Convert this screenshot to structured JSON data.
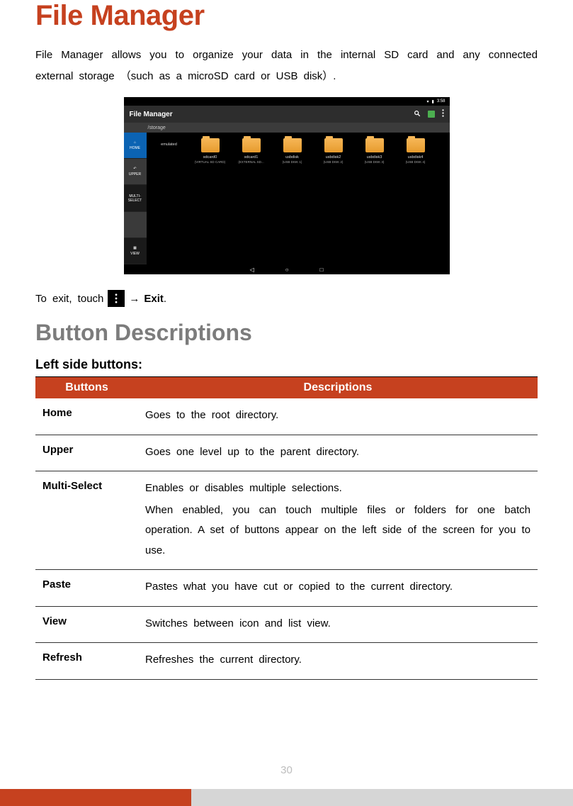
{
  "title": "File Manager",
  "intro": "File Manager allows you to organize your data in the internal SD card and any connected external storage （such as a microSD card or USB disk）.",
  "screenshot": {
    "status_time": "3:58",
    "app_title": "File Manager",
    "path": "/storage",
    "sidebar": [
      "HOME",
      "UPPER",
      "MULTI-SELECT",
      "",
      "VIEW"
    ],
    "items": [
      {
        "label": "emulated",
        "sub": ""
      },
      {
        "label": "sdcard0",
        "sub": "(VIRTUAL SD CARD)"
      },
      {
        "label": "sdcard1",
        "sub": "(EXTERNAL SD..."
      },
      {
        "label": "usbdisk",
        "sub": "(USB DISK 1)"
      },
      {
        "label": "usbdisk2",
        "sub": "(USB DISK 2)"
      },
      {
        "label": "usbdisk3",
        "sub": "(USB DISK 3)"
      },
      {
        "label": "usbdisk4",
        "sub": "(USB DISK 4)"
      }
    ],
    "nav": [
      "◁",
      "○",
      "□"
    ]
  },
  "exit": {
    "pre": "To exit, touch",
    "arrow": "→",
    "exit_label": "Exit",
    "post": "."
  },
  "subtitle": "Button Descriptions",
  "left_side_heading": "Left side buttons:",
  "table": {
    "header_buttons": "Buttons",
    "header_desc": "Descriptions",
    "rows": [
      {
        "name": "Home",
        "desc": [
          "Goes to the root directory."
        ]
      },
      {
        "name": "Upper",
        "desc": [
          "Goes one level up to the parent directory."
        ]
      },
      {
        "name": "Multi-Select",
        "desc": [
          "Enables or disables multiple selections.",
          "When enabled, you can touch multiple files or folders for one batch operation. A set of buttons appear on the left side of the screen for you to use."
        ]
      },
      {
        "name": "Paste",
        "desc": [
          "Pastes what you have cut or copied to the current directory."
        ]
      },
      {
        "name": "View",
        "desc": [
          "Switches between icon and list view."
        ]
      },
      {
        "name": "Refresh",
        "desc": [
          "Refreshes the current directory."
        ]
      }
    ]
  },
  "page_number": "30"
}
